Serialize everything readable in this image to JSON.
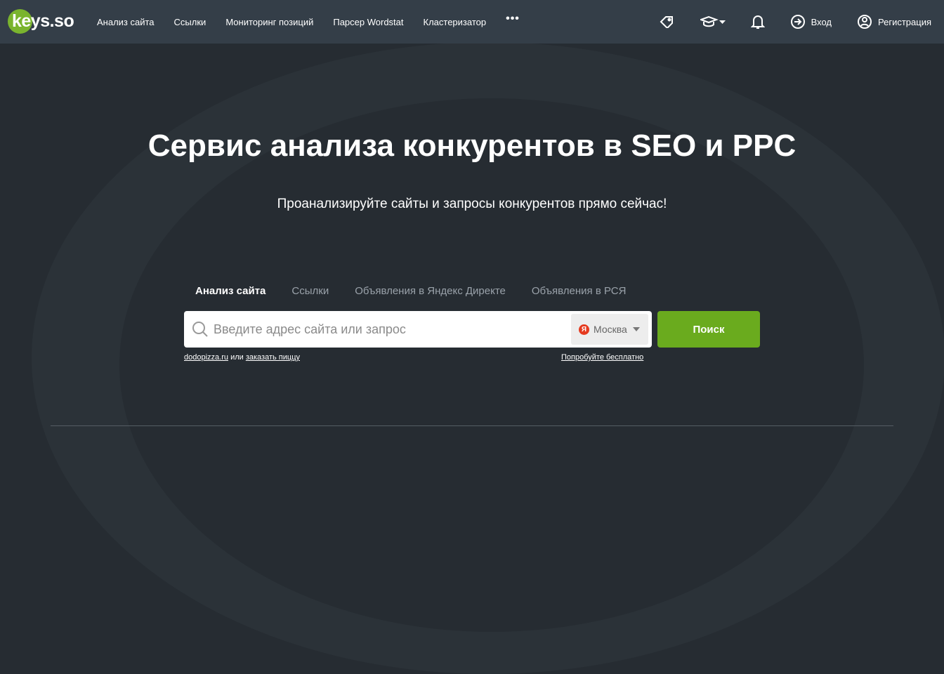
{
  "header": {
    "logo": "keys.so",
    "nav": [
      "Анализ сайта",
      "Ссылки",
      "Мониторинг позиций",
      "Парсер Wordstat",
      "Кластеризатор"
    ],
    "more": "•••",
    "login": "Вход",
    "register": "Регистрация"
  },
  "hero": {
    "title": "Сервис анализа конкурентов в SEO и PPC",
    "subtitle": "Проанализируйте сайты и запросы конкурентов прямо сейчас!"
  },
  "search": {
    "tabs": [
      "Анализ сайта",
      "Ссылки",
      "Объявления в Яндекс Директе",
      "Объявления в РСЯ"
    ],
    "placeholder": "Введите адрес сайта или запрос",
    "region_badge": "Я",
    "region": "Москва",
    "button": "Поиск",
    "example_site": "dodopizza.ru",
    "example_or": "или",
    "example_query": "заказать пиццу",
    "try_free": "Попробуйте бесплатно"
  },
  "colors": {
    "accent": "#6aab1e",
    "header": "#343e48",
    "background": "#262c32"
  }
}
